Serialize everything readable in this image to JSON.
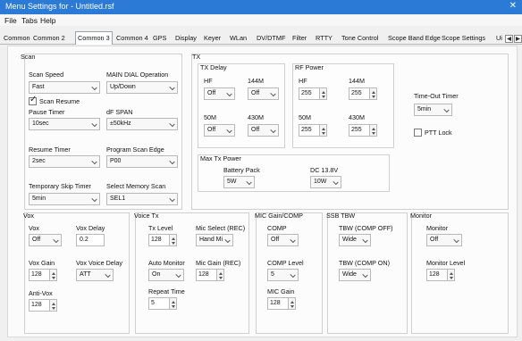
{
  "window": {
    "title": "Menu Settings for - Untitled.rsf",
    "close": "✕"
  },
  "menu": [
    "File",
    "Tabs",
    "Help"
  ],
  "tabs": [
    "Common",
    "Common 2",
    "Common 3",
    "Common 4",
    "GPS",
    "Display",
    "Keyer",
    "WLan",
    "DV/DTMF",
    "Filter",
    "RTTY",
    "Tone Control",
    "Scope Band Edge",
    "Scope Settings",
    "Ui"
  ],
  "scan": {
    "title": "Scan",
    "scan_speed": {
      "label": "Scan Speed",
      "value": "Fast"
    },
    "main_dial": {
      "label": "MAIN DIAL Operation",
      "value": "Up/Down"
    },
    "scan_resume": {
      "label": "Scan Resume",
      "checked": true
    },
    "pause_timer": {
      "label": "Pause Timer",
      "value": "10sec"
    },
    "df_span": {
      "label": "dF SPAN",
      "value": "±50kHz"
    },
    "resume_timer": {
      "label": "Resume Timer",
      "value": "2sec"
    },
    "program_scan_edge": {
      "label": "Program Scan Edge",
      "value": "P00"
    },
    "temp_skip_timer": {
      "label": "Temporary Skip Timer",
      "value": "5min"
    },
    "select_memory_scan": {
      "label": "Select Memory Scan",
      "value": "SEL1"
    }
  },
  "tx": {
    "title": "TX",
    "tx_delay": {
      "title": "TX Delay",
      "hf": {
        "label": "HF",
        "value": "Off"
      },
      "m144": {
        "label": "144M",
        "value": "Off"
      },
      "m50": {
        "label": "50M",
        "value": "Off"
      },
      "m430": {
        "label": "430M",
        "value": "Off"
      }
    },
    "rf_power": {
      "title": "RF Power",
      "hf": {
        "label": "HF",
        "value": "255"
      },
      "m144": {
        "label": "144M",
        "value": "255"
      },
      "m50": {
        "label": "50M",
        "value": "255"
      },
      "m430": {
        "label": "430M",
        "value": "255"
      }
    },
    "timeout_timer": {
      "label": "Time-Out Timer",
      "value": "5min"
    },
    "ptt_lock": {
      "label": "PTT Lock",
      "checked": false
    },
    "max_tx_power": {
      "title": "Max Tx Power",
      "battery_pack": {
        "label": "Battery Pack",
        "value": "5W"
      },
      "dc": {
        "label": "DC 13.8V",
        "value": "10W"
      }
    }
  },
  "vox": {
    "title": "Vox",
    "vox": {
      "label": "Vox",
      "value": "Off"
    },
    "vox_delay": {
      "label": "Vox Delay",
      "value": "0.2"
    },
    "vox_gain": {
      "label": "Vox Gain",
      "value": "128"
    },
    "vox_voice_delay": {
      "label": "Vox Voice Delay",
      "value": "ATT"
    },
    "anti_vox": {
      "label": "Anti-Vox",
      "value": "128"
    }
  },
  "voice_tx": {
    "title": "Voice Tx",
    "tx_level": {
      "label": "Tx Level",
      "value": "128"
    },
    "mic_select": {
      "label": "Mic Select (REC)",
      "value": "Hand Mi"
    },
    "auto_monitor": {
      "label": "Auto Monitor",
      "value": "On"
    },
    "mic_gain_rec": {
      "label": "Mic Gain (REC)",
      "value": "128"
    },
    "repeat_time": {
      "label": "Repeat Time",
      "value": "5"
    }
  },
  "mic_gain_comp": {
    "title": "MIC Gain/COMP",
    "comp": {
      "label": "COMP",
      "value": "Off"
    },
    "comp_level": {
      "label": "COMP Level",
      "value": "5"
    },
    "mic_gain": {
      "label": "MIC Gain",
      "value": "128"
    }
  },
  "ssb_tbw": {
    "title": "SSB TBW",
    "tbw_comp_off": {
      "label": "TBW (COMP OFF)",
      "value": "Wide"
    },
    "tbw_comp_on": {
      "label": "TBW (COMP ON)",
      "value": "Wide"
    }
  },
  "monitor": {
    "title": "Monitor",
    "monitor": {
      "label": "Monitor",
      "value": "Off"
    },
    "monitor_level": {
      "label": "Monitor Level",
      "value": "128"
    }
  }
}
